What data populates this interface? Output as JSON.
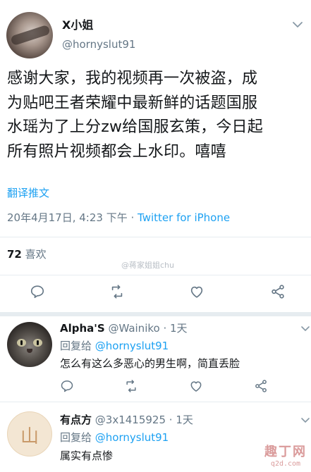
{
  "tweet": {
    "author_name": "X小姐",
    "author_handle": "@hornyslut91",
    "text_lines": [
      "感谢大家，我的视频再一次被盗，成",
      "为贴吧王者荣耀中最新鲜的话题国服",
      "水瑶为了上分zw给国服玄策，今日起",
      "所有照片视频都会上水印。嘻嘻"
    ],
    "translate_label": "翻译推文",
    "timestamp": "20年4月17日, 4:23 下午",
    "separator": " · ",
    "source": "Twitter for iPhone",
    "like_count": "72",
    "like_label": " 喜欢",
    "overlay_watermark": "@蒋家姐姐chu",
    "actions": [
      "reply-icon",
      "retweet-icon",
      "like-icon",
      "share-icon"
    ]
  },
  "replies": [
    {
      "name": "Alpha'S",
      "handle_time": " @Wainiko · 1天",
      "replying_prefix": "回复给 ",
      "replying_to": "@hornyslut91",
      "text": "怎么有这么多恶心的男生啊，简直丢脸"
    },
    {
      "name": "有点方",
      "handle_time": " @3x1415925 · 1天",
      "replying_prefix": "回复给 ",
      "replying_to": "@hornyslut91",
      "text": "属实有点惨"
    }
  ],
  "site_watermark": {
    "main": "趣丁网",
    "domain": "q2d.com"
  },
  "colors": {
    "accent": "#1da1f2",
    "secondary": "#657786",
    "border": "#e6ecf0"
  }
}
